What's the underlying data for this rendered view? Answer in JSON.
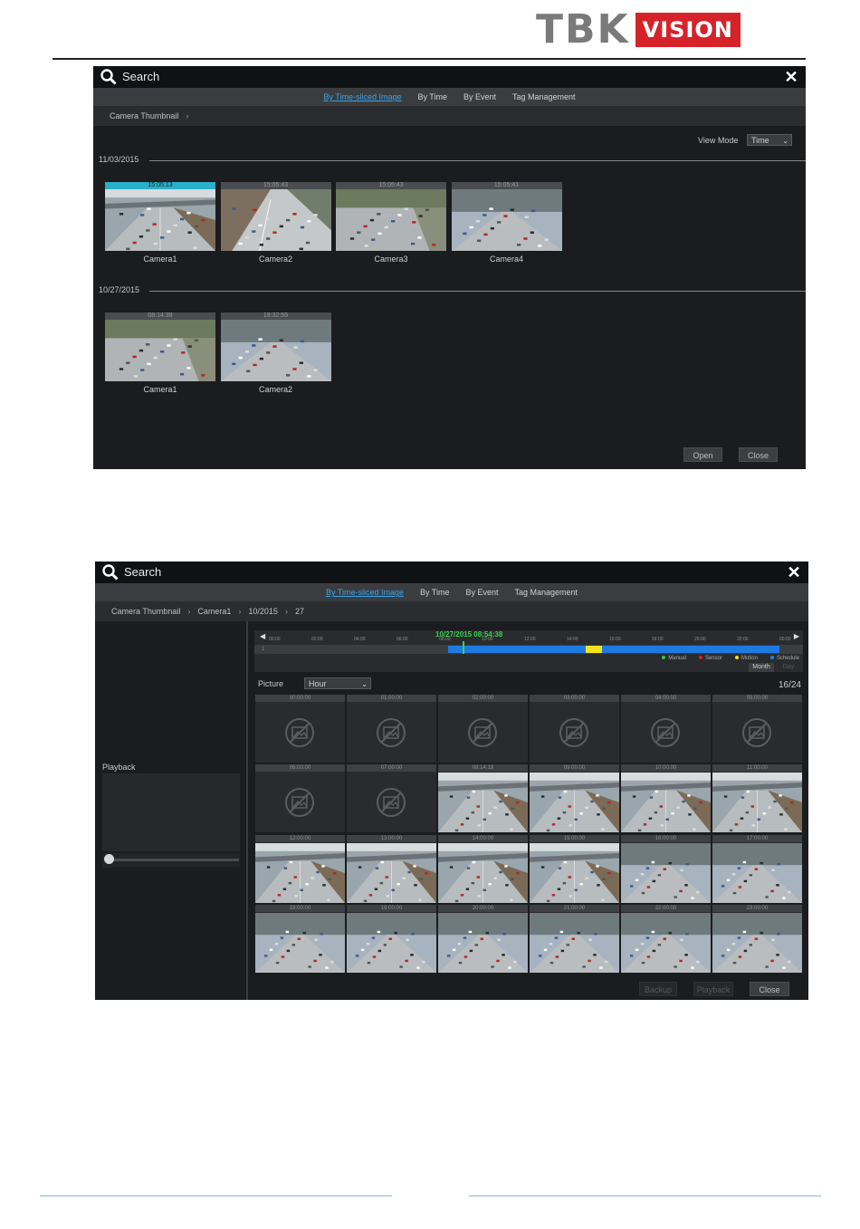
{
  "brand": {
    "part1": "TBK",
    "part2": "VISION",
    "accent": "#d6232a"
  },
  "dialog1": {
    "title": "Search",
    "tabs": [
      "By Time-sliced Image",
      "By Time",
      "By Event",
      "Tag Management"
    ],
    "active_tab": 0,
    "breadcrumb": [
      "Camera Thumbnail"
    ],
    "view_mode_label": "View Mode",
    "view_mode_value": "Time",
    "groups": [
      {
        "date": "11/03/2015",
        "thumbs": [
          {
            "time": "15:05:13",
            "camera": "Camera1",
            "selected": true
          },
          {
            "time": "15:05:43",
            "camera": "Camera2"
          },
          {
            "time": "15:05:43",
            "camera": "Camera3"
          },
          {
            "time": "15:05:41",
            "camera": "Camera4"
          }
        ]
      },
      {
        "date": "10/27/2015",
        "thumbs": [
          {
            "time": "08:14:38",
            "camera": "Camera1"
          },
          {
            "time": "19:32:55",
            "camera": "Camera2"
          }
        ]
      }
    ],
    "buttons": {
      "open": "Open",
      "close": "Close"
    }
  },
  "dialog2": {
    "title": "Search",
    "tabs": [
      "By Time-sliced Image",
      "By Time",
      "By Event",
      "Tag Management"
    ],
    "active_tab": 0,
    "breadcrumb": [
      "Camera Thumbnail",
      "Camera1",
      "10/2015",
      "27"
    ],
    "playback_label": "Playback",
    "timeline": {
      "cursor_label": "10/27/2015 08:54:38",
      "ticks": [
        "00:00",
        "02:00",
        "04:00",
        "06:00",
        "08:00",
        "10:00",
        "12:00",
        "14:00",
        "16:00",
        "18:00",
        "20:00",
        "22:00",
        "00:00"
      ],
      "legend": [
        "Manual",
        "Sensor",
        "Motion",
        "Schedule"
      ],
      "legend_colors": [
        "#2ecc40",
        "#e02020",
        "#f0e020",
        "#2a7fe0"
      ],
      "channel": "1"
    },
    "month_label": "Month",
    "day_label": "Day",
    "picture_label": "Picture",
    "picture_mode": "Hour",
    "page_count": "16/24",
    "cells": [
      {
        "time": "00:00:00",
        "has_image": false
      },
      {
        "time": "01:00:00",
        "has_image": false
      },
      {
        "time": "02:00:00",
        "has_image": false
      },
      {
        "time": "03:00:00",
        "has_image": false
      },
      {
        "time": "04:00:00",
        "has_image": false
      },
      {
        "time": "05:00:00",
        "has_image": false
      },
      {
        "time": "06:00:00",
        "has_image": false
      },
      {
        "time": "07:00:00",
        "has_image": false
      },
      {
        "time": "08:14:18",
        "has_image": true
      },
      {
        "time": "09:00:00",
        "has_image": true
      },
      {
        "time": "10:00:00",
        "has_image": true
      },
      {
        "time": "11:00:00",
        "has_image": true
      },
      {
        "time": "12:00:00",
        "has_image": true
      },
      {
        "time": "13:00:00",
        "has_image": true
      },
      {
        "time": "14:00:00",
        "has_image": true
      },
      {
        "time": "15:00:00",
        "has_image": true
      },
      {
        "time": "16:00:00",
        "has_image": true
      },
      {
        "time": "17:00:00",
        "has_image": true
      },
      {
        "time": "18:00:00",
        "has_image": true
      },
      {
        "time": "19:00:00",
        "has_image": true
      },
      {
        "time": "20:00:00",
        "has_image": true
      },
      {
        "time": "21:00:00",
        "has_image": true
      },
      {
        "time": "22:00:00",
        "has_image": true
      },
      {
        "time": "23:00:00",
        "has_image": true
      }
    ],
    "buttons": {
      "backup": "Backup",
      "playback": "Playback",
      "close": "Close"
    }
  }
}
